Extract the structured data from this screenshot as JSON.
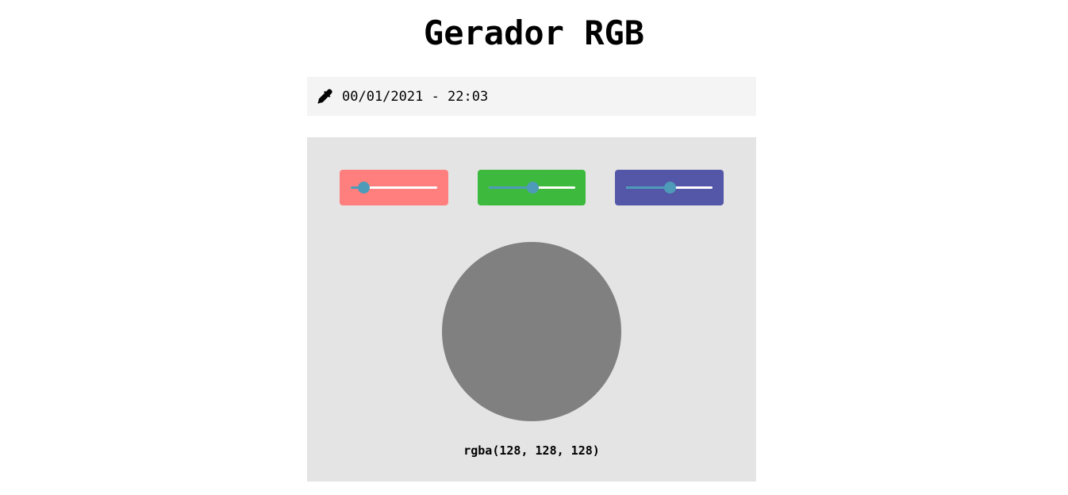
{
  "header": {
    "title": "Gerador RGB"
  },
  "datebar": {
    "icon": "eyedropper-icon",
    "text": "00/01/2021 - 22:03"
  },
  "sliders": [
    {
      "channel": "red",
      "value": 128,
      "fill_fraction": 0.15,
      "bg_color": "#ff7f7f"
    },
    {
      "channel": "green",
      "value": 128,
      "fill_fraction": 0.5,
      "bg_color": "#3dba3d"
    },
    {
      "channel": "blue",
      "value": 128,
      "fill_fraction": 0.5,
      "bg_color": "#5457a8"
    }
  ],
  "colors": {
    "panel_bg": "#e4e4e4",
    "datebar_bg": "#f4f4f4",
    "slider_accent": "#4e9bb9",
    "swatch": "#808080"
  },
  "result": {
    "code": "rgba(128, 128, 128)"
  }
}
